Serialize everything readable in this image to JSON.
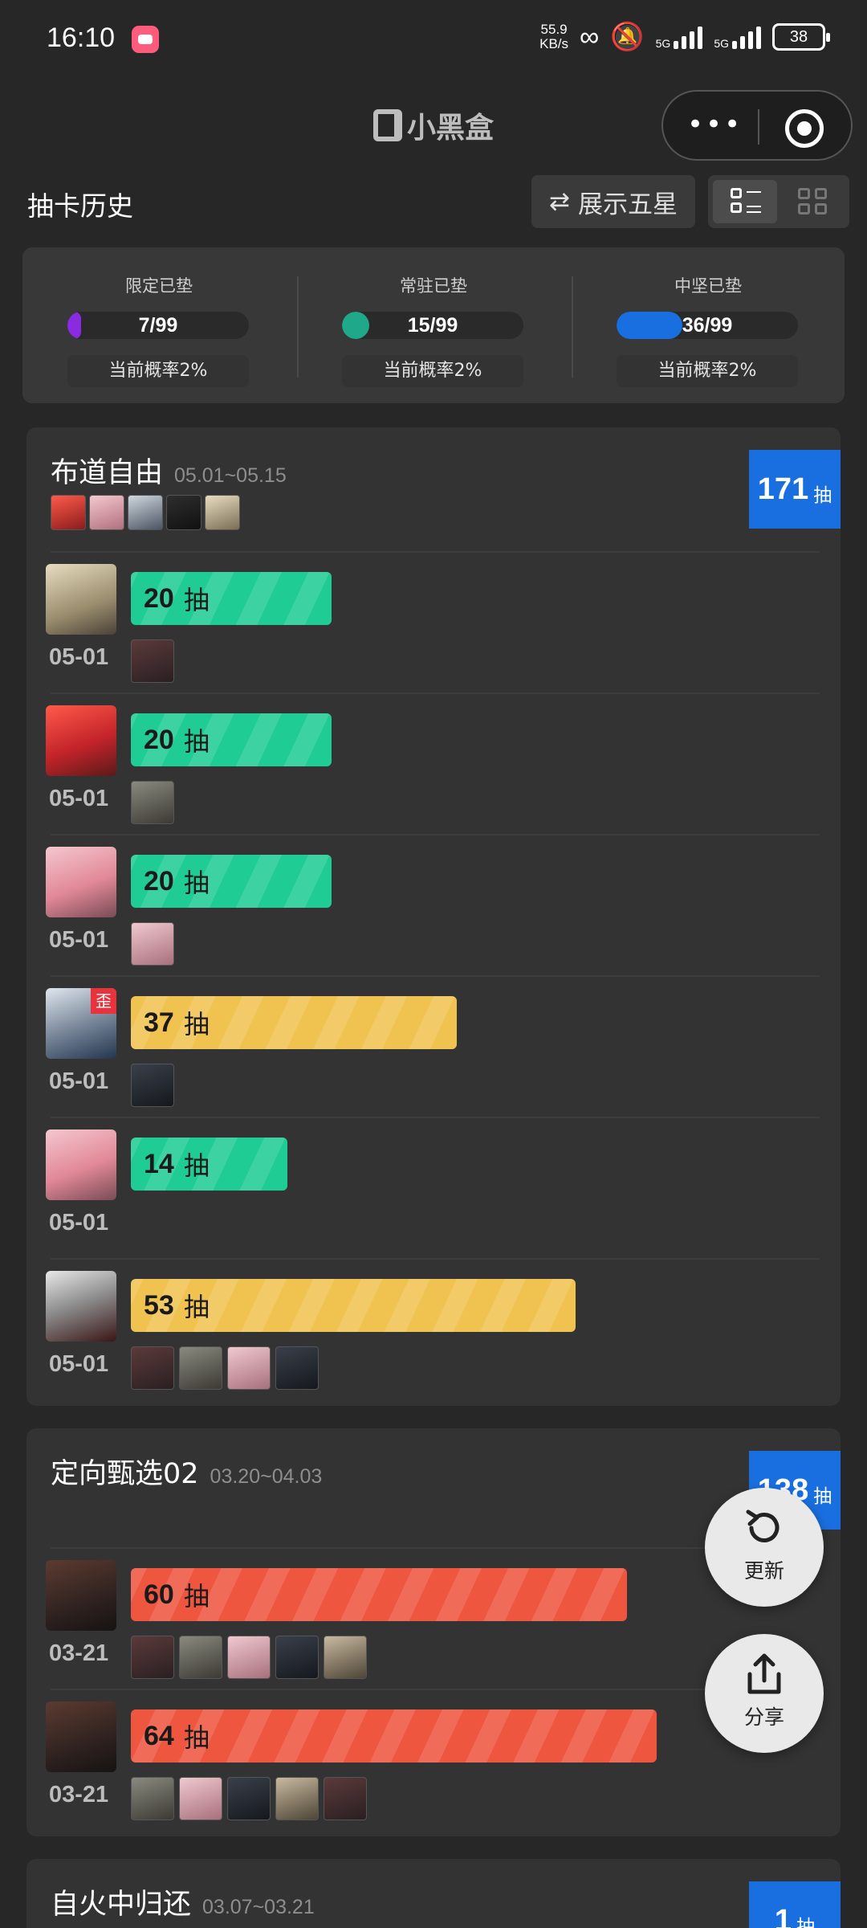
{
  "status_bar": {
    "time": "16:10",
    "net_speed_value": "55.9",
    "net_speed_unit": "KB/s",
    "sim1": "5G",
    "sim2": "5G",
    "battery": "38"
  },
  "title_bar": {
    "brand": "小黑盒",
    "more_icon": "more-icon",
    "close_icon": "target-icon"
  },
  "header": {
    "title": "抽卡历史",
    "toggle_label": "展示五星",
    "toggle_icon": "swap-icon"
  },
  "pity_summary": [
    {
      "label": "限定已垫",
      "current": 7,
      "max": 99,
      "value_text": "7/99",
      "rate_text": "当前概率2%",
      "color": "#8a2be2"
    },
    {
      "label": "常驻已垫",
      "current": 15,
      "max": 99,
      "value_text": "15/99",
      "rate_text": "当前概率2%",
      "color": "#1fa88a"
    },
    {
      "label": "中坚已垫",
      "current": 36,
      "max": 99,
      "value_text": "36/99",
      "rate_text": "当前概率2%",
      "color": "#1a6fe0"
    }
  ],
  "colors": {
    "teal": "#1fcc93",
    "yellow": "#f0c250",
    "red": "#ee5640",
    "badge_blue": "#1a6fe0",
    "tag_red": "#e8323c"
  },
  "banners": [
    {
      "name": "布道自由",
      "dates": "05.01~05.15",
      "total": "171",
      "unit": "抽",
      "pulls": [
        {
          "date": "05-01",
          "count": 20,
          "count_text": "20",
          "unit": "抽",
          "color": "#1fcc93",
          "off_banner": false,
          "minis": 1
        },
        {
          "date": "05-01",
          "count": 20,
          "count_text": "20",
          "unit": "抽",
          "color": "#1fcc93",
          "off_banner": false,
          "minis": 1
        },
        {
          "date": "05-01",
          "count": 20,
          "count_text": "20",
          "unit": "抽",
          "color": "#1fcc93",
          "off_banner": false,
          "minis": 1
        },
        {
          "date": "05-01",
          "count": 37,
          "count_text": "37",
          "unit": "抽",
          "color": "#f0c250",
          "off_banner": true,
          "off_label": "歪",
          "minis": 1
        },
        {
          "date": "05-01",
          "count": 14,
          "count_text": "14",
          "unit": "抽",
          "color": "#1fcc93",
          "off_banner": false,
          "minis": 0
        },
        {
          "date": "05-01",
          "count": 53,
          "count_text": "53",
          "unit": "抽",
          "color": "#f0c250",
          "off_banner": false,
          "minis": 4
        }
      ]
    },
    {
      "name": "定向甄选02",
      "dates": "03.20~04.03",
      "total": "138",
      "unit": "抽",
      "pulls": [
        {
          "date": "03-21",
          "count": 60,
          "count_text": "60",
          "unit": "抽",
          "color": "#ee5640",
          "off_banner": false,
          "minis": 5
        },
        {
          "date": "03-21",
          "count": 64,
          "count_text": "64",
          "unit": "抽",
          "color": "#ee5640",
          "off_banner": false,
          "minis": 5
        }
      ]
    },
    {
      "name": "自火中归还",
      "dates": "03.07~03.21",
      "total": "1",
      "unit": "抽",
      "pulls": []
    }
  ],
  "fabs": {
    "refresh_label": "更新",
    "share_label": "分享"
  }
}
